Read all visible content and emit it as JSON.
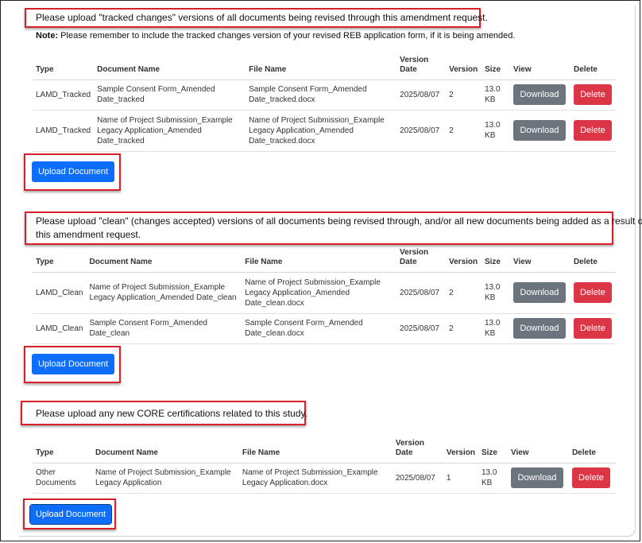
{
  "section1": {
    "callout": "Please upload \"tracked changes\" versions of all documents being revised through this amendment request.",
    "note_label": "Note:",
    "note_text": " Please remember to include the tracked changes version of your revised REB application form, if it is being amended.",
    "headers": {
      "type": "Type",
      "name": "Document Name",
      "file": "File Name",
      "date1": "Version",
      "date2": "Date",
      "version": "Version",
      "size": "Size",
      "view": "View",
      "delete": "Delete"
    },
    "rows": [
      {
        "type": [
          "LAMD_Tracked"
        ],
        "name": [
          "Sample Consent Form_Amended",
          "Date_tracked"
        ],
        "file": [
          "Sample Consent Form_Amended",
          "Date_tracked.docx"
        ],
        "date": "2025/08/07",
        "version": "2",
        "size": [
          "13.0",
          "KB"
        ]
      },
      {
        "type": [
          "LAMD_Tracked"
        ],
        "name": [
          "Name of Project Submission_Example",
          "Legacy Application_Amended Date_tracked"
        ],
        "file": [
          "Name of Project Submission_Example",
          "Legacy Application_Amended",
          "Date_tracked.docx"
        ],
        "date": "2025/08/07",
        "version": "2",
        "size": [
          "13.0",
          "KB"
        ]
      }
    ],
    "upload_label": "Upload Document"
  },
  "section2": {
    "callout_line1": "Please upload \"clean\" (changes accepted) versions of all documents being revised through, and/or all new documents being added as a result of,",
    "callout_line2": "this amendment request.",
    "headers": {
      "type": "Type",
      "name": "Document Name",
      "file": "File Name",
      "date1": "Version",
      "date2": "Date",
      "version": "Version",
      "size": "Size",
      "view": "View",
      "delete": "Delete"
    },
    "rows": [
      {
        "type": [
          "LAMD_Clean"
        ],
        "name": [
          "Name of Project Submission_Example",
          "Legacy Application_Amended Date_clean"
        ],
        "file": [
          "Name of Project Submission_Example",
          "Legacy Application_Amended",
          "Date_clean.docx"
        ],
        "date": "2025/08/07",
        "version": "2",
        "size": [
          "13.0",
          "KB"
        ]
      },
      {
        "type": [
          "LAMD_Clean"
        ],
        "name": [
          "Sample Consent Form_Amended",
          "Date_clean"
        ],
        "file": [
          "Sample Consent Form_Amended",
          "Date_clean.docx"
        ],
        "date": "2025/08/07",
        "version": "2",
        "size": [
          "13.0",
          "KB"
        ]
      }
    ],
    "upload_label": "Upload Document"
  },
  "section3": {
    "callout": "Please upload any new CORE certifications related to this study.",
    "headers": {
      "type": "Type",
      "name": "Document Name",
      "file": "File Name",
      "date1": "Version",
      "date2": "Date",
      "version": "Version",
      "size": "Size",
      "view": "View",
      "delete": "Delete"
    },
    "rows": [
      {
        "type": [
          "Other",
          "Documents"
        ],
        "name": [
          "Name of Project Submission_Example",
          "Legacy Application"
        ],
        "file": [
          "Name of Project Submission_Example",
          "Legacy Application.docx"
        ],
        "date": "2025/08/07",
        "version": "1",
        "size": [
          "13.0",
          "KB"
        ]
      }
    ],
    "upload_label": "Upload Document"
  },
  "buttons": {
    "download": "Download",
    "delete": "Delete"
  },
  "colors": {
    "highlight": "#d6202a",
    "primary": "#0d6efd",
    "secondary": "#6c757d",
    "danger": "#dc3545"
  }
}
